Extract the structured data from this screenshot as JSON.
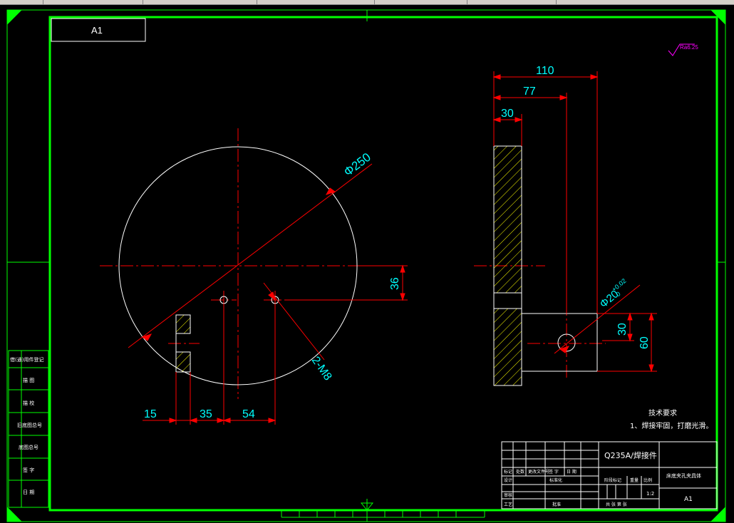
{
  "sheet": {
    "size_label": "A1",
    "roughness": "Ra6.25"
  },
  "dimensions": {
    "front": {
      "diameter": "Φ250",
      "offset_36": "36",
      "thread": "2-M8",
      "d15": "15",
      "d35": "35",
      "d54": "54"
    },
    "side": {
      "d110": "110",
      "d77": "77",
      "d30_top": "30",
      "bore": "Φ20",
      "bore_tol_upper": "+0.02",
      "bore_tol_lower": "0",
      "d30_right": "30",
      "d60": "60"
    }
  },
  "notes": {
    "title": "技术要求",
    "item1": "1、焊接牢固，打磨光滑。"
  },
  "title_block": {
    "material": "Q235A/焊接件",
    "drawing_name": "床底夹孔夹具体",
    "sheet_size": "A1",
    "scale": "1:2",
    "left_labels": [
      "借(通)用件登记",
      "描 图",
      "描 校",
      "旧底图总号",
      "底图总号",
      "签 字",
      "日 期"
    ],
    "row_labels": [
      "标记",
      "处数",
      "更改文件号",
      "签 字",
      "日 期"
    ],
    "design": "设计",
    "standard": "标准化",
    "review": "审核",
    "process": "工艺",
    "approve": "批准",
    "stage": "阶段标记",
    "weight": "重量",
    "ratio": "比例",
    "sheet_count": "共  张  第  张"
  },
  "colors": {
    "frame": "#00ff00",
    "outline": "#ffffff",
    "dimension": "#ff0000",
    "dim_text": "#00ffff",
    "hatch": "#ffff00",
    "roughness": "#ff00ff"
  }
}
